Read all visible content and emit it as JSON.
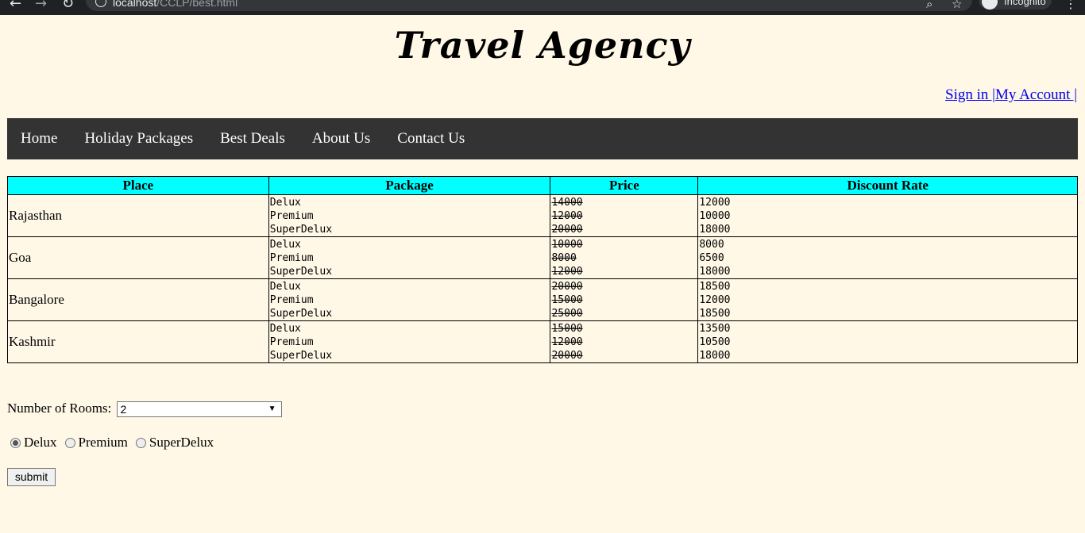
{
  "browser": {
    "url_host": "localhost",
    "url_path": "/CCLP/best.html",
    "incognito_label": "Incognito"
  },
  "header": {
    "title": "Travel Agency",
    "sign_in": "Sign in |",
    "my_account": "My Account |"
  },
  "nav": {
    "items": [
      "Home",
      "Holiday Packages",
      "Best Deals",
      "About Us",
      "Contact Us"
    ]
  },
  "table": {
    "headers": [
      "Place",
      "Package",
      "Price",
      "Discount Rate"
    ],
    "rows": [
      {
        "place": "Rajasthan",
        "packages": [
          "Delux",
          "Premium",
          "SuperDelux"
        ],
        "prices": [
          "14000",
          "12000",
          "20000"
        ],
        "discounts": [
          "12000",
          "10000",
          "18000"
        ]
      },
      {
        "place": "Goa",
        "packages": [
          "Delux",
          "Premium",
          "SuperDelux"
        ],
        "prices": [
          "10000",
          "8000",
          "12000"
        ],
        "discounts": [
          "8000",
          "6500",
          "18000"
        ]
      },
      {
        "place": "Bangalore",
        "packages": [
          "Delux",
          "Premium",
          "SuperDelux"
        ],
        "prices": [
          "20000",
          "15000",
          "25000"
        ],
        "discounts": [
          "18500",
          "12000",
          "18500"
        ]
      },
      {
        "place": "Kashmir",
        "packages": [
          "Delux",
          "Premium",
          "SuperDelux"
        ],
        "prices": [
          "15000",
          "12000",
          "20000"
        ],
        "discounts": [
          "13500",
          "10500",
          "18000"
        ]
      }
    ]
  },
  "form": {
    "rooms_label": "Number of Rooms:",
    "rooms_value": "2",
    "radio_options": [
      "Delux",
      "Premium",
      "SuperDelux"
    ],
    "selected_option": "Delux",
    "submit_label": "submit"
  },
  "colors": {
    "page_bg": "#fff8e7",
    "nav_bg": "#333333",
    "table_header_bg": "#00ffff",
    "link": "#0000ee"
  }
}
